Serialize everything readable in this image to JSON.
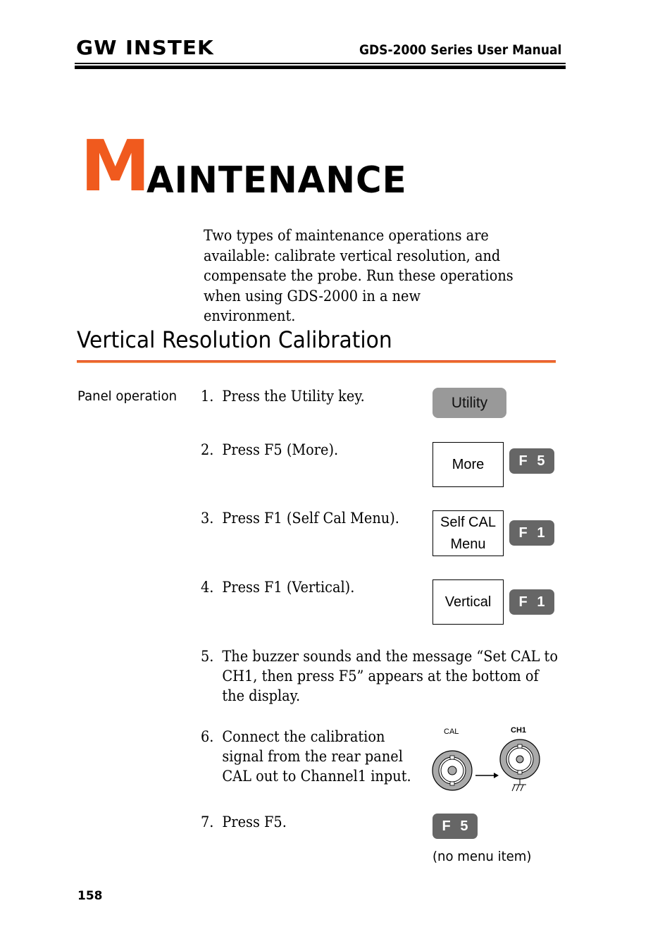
{
  "header": {
    "brand": "GW INSTEK",
    "manual_title": "GDS-2000 Series User Manual"
  },
  "chapter": {
    "initial": "M",
    "rest": "AINTENANCE",
    "intro": "Two types of maintenance operations are available: calibrate vertical resolution, and compensate the probe. Run these operations when using GDS-2000 in a new environment."
  },
  "section": {
    "title": "Vertical Resolution Calibration",
    "panel_label": "Panel operation"
  },
  "steps": [
    {
      "num": "1.",
      "text": "Press the Utility key."
    },
    {
      "num": "2.",
      "text": "Press F5 (More)."
    },
    {
      "num": "3.",
      "text": "Press F1 (Self Cal Menu)."
    },
    {
      "num": "4.",
      "text": "Press F1 (Vertical)."
    },
    {
      "num": "5.",
      "text": "The buzzer sounds and the message “Set CAL to CH1, then press F5” appears at the bottom of the display."
    },
    {
      "num": "6.",
      "text": "Connect the calibration signal from the rear panel CAL out to Channel1 input."
    },
    {
      "num": "7.",
      "text": "Press F5."
    }
  ],
  "keys": {
    "utility": "Utility",
    "more": "More",
    "selfcal_line1": "Self CAL",
    "selfcal_line2": "Menu",
    "vertical": "Vertical",
    "f5": "F 5",
    "f1": "F 1",
    "f1b": "F 1",
    "f5b": "F 5"
  },
  "diagram": {
    "cal_label": "CAL",
    "ch1_label": "CH1"
  },
  "no_menu_item": "(no menu item)",
  "page_number": "158",
  "colors": {
    "accent": "#f05a1e",
    "key_gray": "#999999",
    "fkey_dark": "#666666"
  }
}
